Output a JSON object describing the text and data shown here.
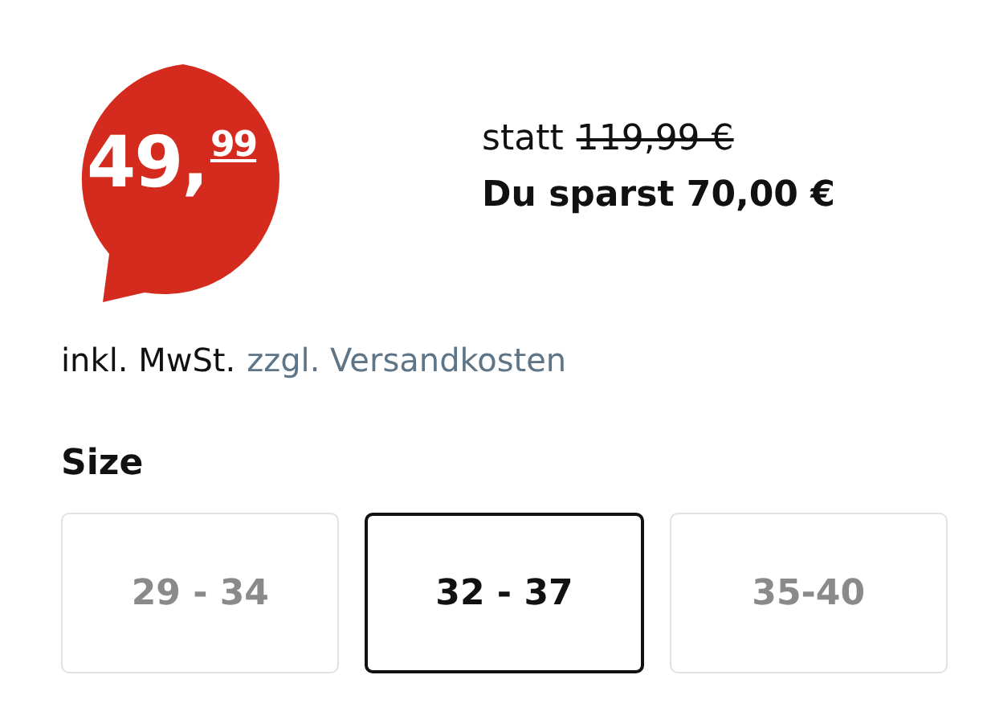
{
  "price": {
    "main": "49,",
    "cents": "99"
  },
  "old_price": {
    "label": "statt",
    "value": "119,99 €"
  },
  "savings": "Du sparst 70,00 €",
  "tax_note": {
    "text": "inkl. MwSt.",
    "link": "zzgl. Versandkosten"
  },
  "size": {
    "title": "Size",
    "options": [
      {
        "label": "29 - 34",
        "selected": false
      },
      {
        "label": "32 - 37",
        "selected": true
      },
      {
        "label": "35-40",
        "selected": false
      }
    ]
  }
}
